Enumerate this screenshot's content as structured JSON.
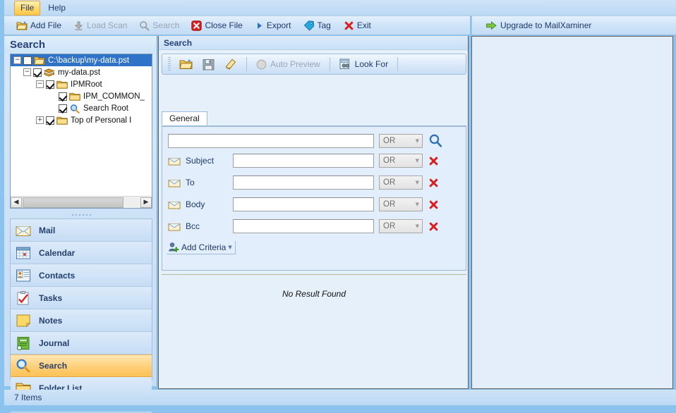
{
  "menubar": {
    "items": [
      {
        "label": "File",
        "active": true
      },
      {
        "label": "Help",
        "active": false
      }
    ]
  },
  "toolbar": {
    "buttons": [
      {
        "label": "Add File",
        "icon": "open-folder-icon",
        "disabled": false
      },
      {
        "label": "Load Scan",
        "icon": "download-icon",
        "disabled": true
      },
      {
        "label": "Search",
        "icon": "magnifier-icon",
        "disabled": true
      },
      {
        "label": "Close File",
        "icon": "close-red-icon",
        "disabled": false
      },
      {
        "label": "Export",
        "icon": "play-triangle-icon",
        "disabled": false
      },
      {
        "label": "Tag",
        "icon": "tag-icon",
        "disabled": false
      },
      {
        "label": "Exit",
        "icon": "x-icon",
        "disabled": false
      }
    ],
    "upgrade": {
      "label": "Upgrade to MailXaminer",
      "icon": "green-arrow-icon"
    }
  },
  "left_pane": {
    "title": "Search",
    "tree": [
      {
        "label": "C:\\backup\\my-data.pst",
        "depth": 0,
        "expander": "minus",
        "checked": false,
        "icon": "folder-open-icon",
        "selected": true
      },
      {
        "label": "my-data.pst",
        "depth": 1,
        "expander": "minus",
        "checked": true,
        "icon": "pst-file-icon",
        "selected": false
      },
      {
        "label": "IPMRoot",
        "depth": 2,
        "expander": "minus",
        "checked": true,
        "icon": "folder-icon",
        "selected": false
      },
      {
        "label": "IPM_COMMON_",
        "depth": 3,
        "expander": "none",
        "checked": true,
        "icon": "folder-icon",
        "selected": false
      },
      {
        "label": "Search Root",
        "depth": 3,
        "expander": "none",
        "checked": true,
        "icon": "search-folder-icon",
        "selected": false
      },
      {
        "label": "Top of Personal I",
        "depth": 2,
        "expander": "plus",
        "checked": true,
        "icon": "folder-icon",
        "selected": false
      }
    ],
    "nav_items": [
      {
        "label": "Mail",
        "icon": "mail-icon",
        "selected": false
      },
      {
        "label": "Calendar",
        "icon": "calendar-icon",
        "selected": false
      },
      {
        "label": "Contacts",
        "icon": "contacts-icon",
        "selected": false
      },
      {
        "label": "Tasks",
        "icon": "tasks-icon",
        "selected": false
      },
      {
        "label": "Notes",
        "icon": "notes-icon",
        "selected": false
      },
      {
        "label": "Journal",
        "icon": "journal-icon",
        "selected": false
      },
      {
        "label": "Search",
        "icon": "search-icon",
        "selected": true
      },
      {
        "label": "Folder List",
        "icon": "folder-list-icon",
        "selected": false
      }
    ]
  },
  "center_pane": {
    "title": "Search",
    "toolbar": [
      {
        "label": "",
        "icon": "open-folder-icon",
        "disabled": false
      },
      {
        "label": "",
        "icon": "save-icon",
        "disabled": false
      },
      {
        "label": "",
        "icon": "eraser-icon",
        "disabled": false
      },
      {
        "label": "Auto Preview",
        "icon": "circle-icon",
        "disabled": true
      },
      {
        "label": "Look For",
        "icon": "look-for-icon",
        "disabled": false
      }
    ],
    "tabs": [
      {
        "label": "General",
        "selected": true
      }
    ],
    "main_search": {
      "value": "",
      "operator": "OR",
      "search_icon": "magnifier-icon"
    },
    "criteria": [
      {
        "label": "Subject",
        "value": "",
        "operator": "OR",
        "icon": "envelope-icon",
        "remove": "remove-icon"
      },
      {
        "label": "To",
        "value": "",
        "operator": "OR",
        "icon": "envelope-icon",
        "remove": "remove-icon"
      },
      {
        "label": "Body",
        "value": "",
        "operator": "OR",
        "icon": "envelope-icon",
        "remove": "remove-icon"
      },
      {
        "label": "Bcc",
        "value": "",
        "operator": "OR",
        "icon": "envelope-icon",
        "remove": "remove-icon"
      }
    ],
    "add_criteria": {
      "label": "Add Criteria",
      "icon": "add-person-icon",
      "dropdown": "chevron-down-icon"
    },
    "results": {
      "empty_message": "No Result Found"
    }
  },
  "status_bar": {
    "text": "7 Items"
  },
  "colors": {
    "window_frame": "#8cc2ee",
    "accent_blue": "#1f3a6e",
    "selection_blue": "#2f73c8",
    "selection_orange": "#ffc257",
    "red": "#d91f1f",
    "green": "#5fa832"
  }
}
